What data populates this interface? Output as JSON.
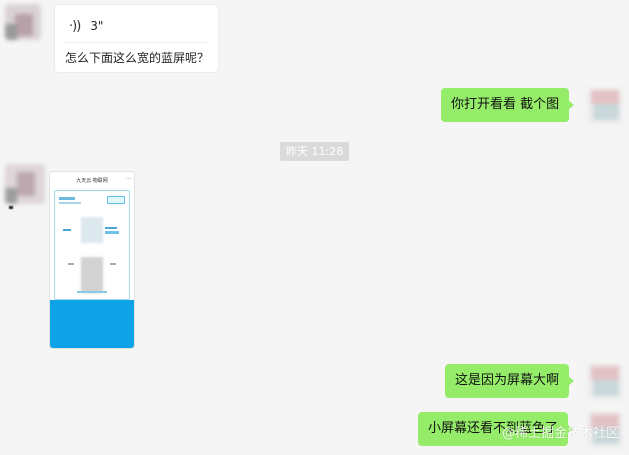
{
  "chat": {
    "voice_message": {
      "duration": "3\""
    },
    "incoming_text_1": "怎么下面这么宽的蓝屏呢？",
    "outgoing_1": "你打开看看 截个图",
    "time_separator": "昨天 11:28",
    "outgoing_2": "这是因为屏幕大啊",
    "outgoing_3": "小屏幕还看不到蓝色了"
  },
  "screenshot_thumbnail": {
    "page_title": "九天云·物联网",
    "bottom_bar_color": "#0ea2e6"
  },
  "watermark": "@稀土掘金技术社区",
  "colors": {
    "outgoing_bubble": "#95ec69",
    "background": "#f5f5f5",
    "time_badge": "#dadada"
  }
}
